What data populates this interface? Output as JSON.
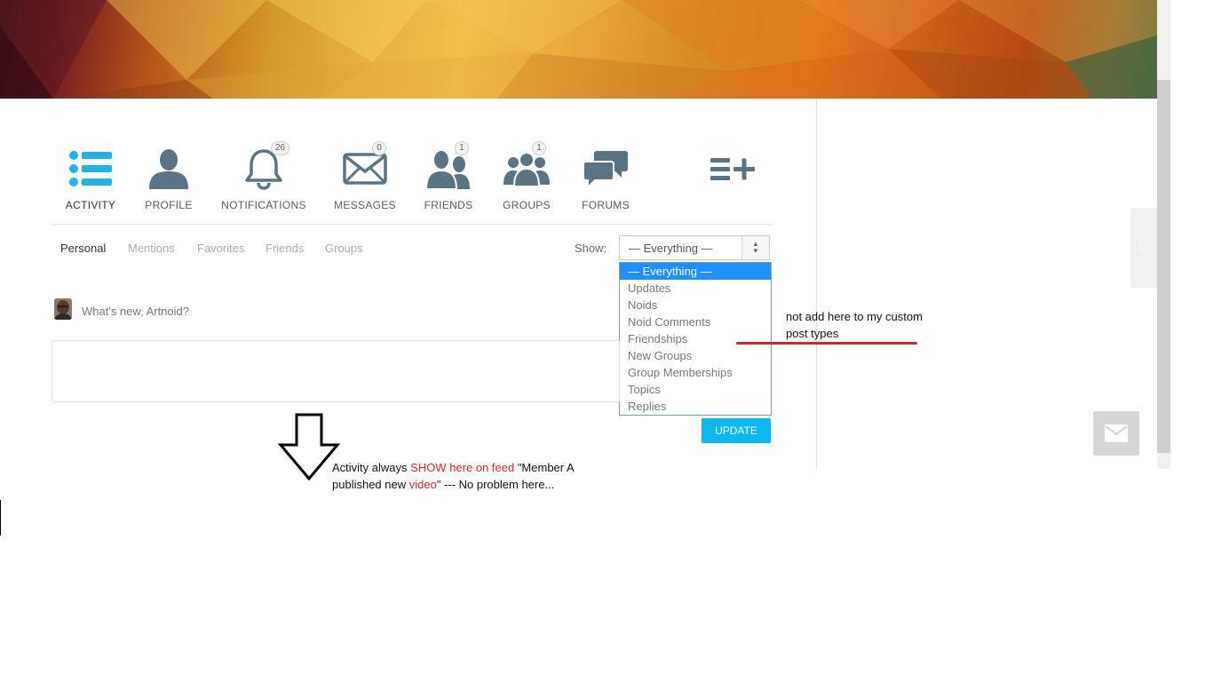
{
  "nav": {
    "items": [
      {
        "id": "activity",
        "label": "ACTIVITY",
        "badge": null
      },
      {
        "id": "profile",
        "label": "PROFILE",
        "badge": null
      },
      {
        "id": "notifications",
        "label": "NOTIFICATIONS",
        "badge": "26"
      },
      {
        "id": "messages",
        "label": "MESSAGES",
        "badge": "0"
      },
      {
        "id": "friends",
        "label": "FRIENDS",
        "badge": "1"
      },
      {
        "id": "groups",
        "label": "GROUPS",
        "badge": "1"
      },
      {
        "id": "forums",
        "label": "FORUMS",
        "badge": null
      }
    ],
    "add_icon": "list-add-icon"
  },
  "filters": {
    "tabs": [
      "Personal",
      "Mentions",
      "Favorites",
      "Friends",
      "Groups"
    ],
    "active": "Personal",
    "show_label": "Show:",
    "selected": "— Everything —",
    "options": [
      "— Everything —",
      "Updates",
      "Noids",
      "Noid Comments",
      "Friendships",
      "New Groups",
      "Group Memberships",
      "Topics",
      "Replies"
    ]
  },
  "composer": {
    "prompt": "What's new, Artnoid?",
    "update_label": "UPDATE"
  },
  "annotations": {
    "right_note": "not add here to my custom post types",
    "bottom_note_1": "Activity always ",
    "bottom_note_show": "SHOW here on feed",
    "bottom_note_2": " \"Member A published new ",
    "bottom_note_video": "video",
    "bottom_note_3": "\"  --- No problem here..."
  },
  "colors": {
    "accent": "#0ab8ef",
    "nav_active_icon": "#1fb3e8",
    "nav_icon": "#5a7483",
    "annotation_red": "#d9232e",
    "dropdown_selected": "#1e90ff"
  }
}
